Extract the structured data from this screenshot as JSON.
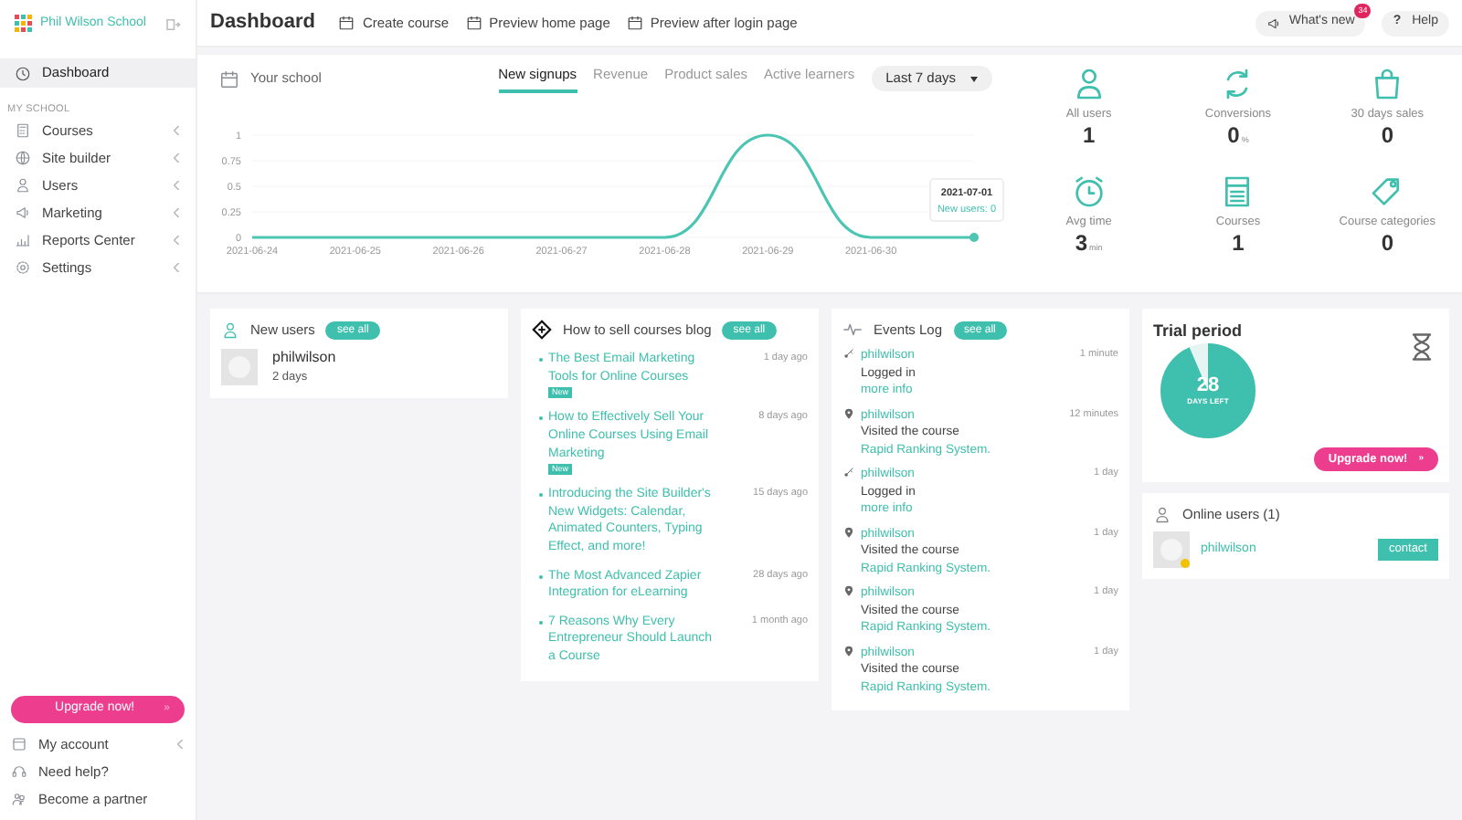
{
  "brand": {
    "name": "Phil Wilson School"
  },
  "sidebar": {
    "top": [
      {
        "label": "Dashboard",
        "selected": true
      }
    ],
    "section": "MY SCHOOL",
    "items": [
      {
        "label": "Courses"
      },
      {
        "label": "Site builder"
      },
      {
        "label": "Users"
      },
      {
        "label": "Marketing"
      },
      {
        "label": "Reports Center"
      },
      {
        "label": "Settings"
      }
    ],
    "upgrade": "Upgrade now!",
    "upgrade_arrow": "»",
    "bottom": [
      {
        "label": "My account",
        "arrow": true
      },
      {
        "label": "Need help?",
        "arrow": false
      },
      {
        "label": "Become a partner",
        "arrow": false
      }
    ]
  },
  "header": {
    "title": "Dashboard",
    "actions": [
      "Create course",
      "Preview home page",
      "Preview after login page"
    ],
    "whats_new": "What's new",
    "badge": "34",
    "help_icon": "?",
    "help": "Help"
  },
  "school": {
    "title": "Your school",
    "tabs": [
      {
        "label": "New signups",
        "selected": true
      },
      {
        "label": "Revenue",
        "selected": false
      },
      {
        "label": "Product sales",
        "selected": false
      },
      {
        "label": "Active learners",
        "selected": false
      }
    ],
    "range": "Last 7 days",
    "chart_data": {
      "type": "line",
      "categories": [
        "2021-06-24",
        "2021-06-25",
        "2021-06-26",
        "2021-06-27",
        "2021-06-28",
        "2021-06-29",
        "2021-06-30",
        "2021-07-01"
      ],
      "series": [
        {
          "color": "#4cc5b3",
          "values": [
            0,
            0,
            0,
            0,
            0,
            1,
            0,
            0
          ]
        }
      ],
      "grid": true,
      "ylim": [
        0,
        1
      ],
      "yticks": [
        0,
        {
          "value": 0.25,
          "label": "0.25"
        },
        {
          "value": 0.5,
          "label": "0.5"
        },
        {
          "value": 0.75,
          "label": "0.75"
        },
        1
      ]
    },
    "tooltip": {
      "text": "New users: 0"
    }
  },
  "stats": [
    {
      "label": "All users",
      "value": "1"
    },
    {
      "label": "Conversions",
      "value": "0",
      "unit": "%"
    },
    {
      "label": "30 days sales",
      "value": "0"
    },
    {
      "label": "Avg time",
      "value": "3",
      "unit": "min"
    },
    {
      "label": "Courses",
      "value": "1"
    },
    {
      "label": "Course categories",
      "value": "0"
    }
  ],
  "new_users": {
    "title": "New users",
    "see_all": "see all",
    "users": [
      {
        "name": "philwilson",
        "time": "2 days"
      }
    ]
  },
  "blog": {
    "title": "How to sell courses blog",
    "see_all": "see all",
    "posts": [
      {
        "title": "The Best Email Marketing Tools for Online Courses",
        "time": "1 day ago",
        "new": true,
        "new_label": "New"
      },
      {
        "title": "How to Effectively Sell Your Online Courses Using Email Marketing",
        "time": "8 days ago",
        "new": true,
        "new_label": "New"
      },
      {
        "title": "Introducing the Site Builder's New Widgets: Calendar, Animated Counters, Typing Effect, and more!",
        "time": "15 days ago",
        "new": false
      },
      {
        "title": "The Most Advanced Zapier Integration for eLearning",
        "time": "28 days ago",
        "new": false
      },
      {
        "title": "7 Reasons Why Every Entrepreneur Should Launch a Course",
        "time": "1 month ago",
        "new": false
      }
    ]
  },
  "events": {
    "title": "Events Log",
    "see_all": "see all",
    "items": [
      {
        "kind": "login",
        "user": "philwilson",
        "time": "1 minute",
        "text": "Logged in",
        "link": "more info"
      },
      {
        "kind": "visit",
        "user": "philwilson",
        "time": "12 minutes",
        "text": "Visited the course",
        "link": "Rapid Ranking System."
      },
      {
        "kind": "login",
        "user": "philwilson",
        "time": "1 day",
        "text": "Logged in",
        "link": "more info"
      },
      {
        "kind": "visit",
        "user": "philwilson",
        "time": "1 day",
        "text": "Visited the course",
        "link": "Rapid Ranking System."
      },
      {
        "kind": "visit",
        "user": "philwilson",
        "time": "1 day",
        "text": "Visited the course",
        "link": "Rapid Ranking System."
      },
      {
        "kind": "visit",
        "user": "philwilson",
        "time": "1 day",
        "text": "Visited the course",
        "link": "Rapid Ranking System."
      }
    ]
  },
  "trial": {
    "title": "Trial period",
    "days": "28",
    "days_label": "DAYS LEFT",
    "level": 0.93,
    "upgrade": "Upgrade now!",
    "upgrade_arrow": "»"
  },
  "online": {
    "title": "Online users (1)",
    "users": [
      {
        "name": "philwilson",
        "online": true,
        "action": "contact"
      }
    ]
  }
}
